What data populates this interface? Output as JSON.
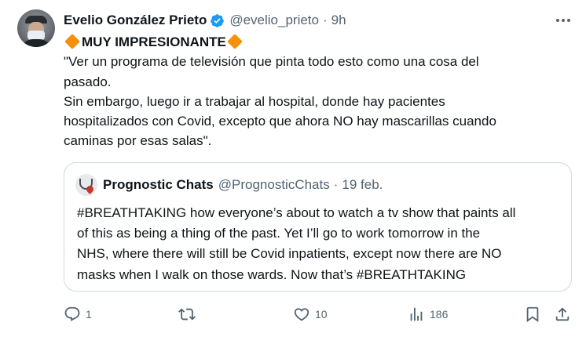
{
  "tweet": {
    "author": {
      "display_name": "Evelio González Prieto",
      "handle": "@evelio_prieto",
      "time": "9h",
      "separator": "·",
      "verified_icon": "verified-badge-icon",
      "avatar": "avatar"
    },
    "headline": "MUY IMPRESIONANTE",
    "headline_emoji": "orange-diamond",
    "body_lines": [
      "\"Ver un programa de televisión que pinta todo esto como una cosa del",
      "pasado.",
      "Sin embargo, luego ir a trabajar al hospital, donde hay pacientes",
      "hospitalizados con Covid, excepto que ahora NO hay mascarillas cuando",
      "caminas por esas salas\"."
    ],
    "more_icon": "more-options-icon",
    "quote": {
      "display_name": "Prognostic Chats",
      "handle": "@PrognosticChats",
      "separator": "·",
      "date": "19 feb.",
      "body_lines": [
        "#BREATHTAKING how everyone’s about to watch a tv show that paints all",
        "of this as being a thing of the past. Yet I’ll go to work tomorrow in the",
        "NHS, where there will still be Covid inpatients, except now there are NO",
        "masks when I walk on those wards. Now that’s #BREATHTAKING"
      ]
    },
    "actions": {
      "reply": {
        "icon": "reply-icon",
        "count": "1"
      },
      "retweet": {
        "icon": "retweet-icon",
        "count": ""
      },
      "like": {
        "icon": "heart-icon",
        "count": "10"
      },
      "views": {
        "icon": "views-chart-icon",
        "count": "186"
      },
      "bookmark": {
        "icon": "bookmark-icon"
      },
      "share": {
        "icon": "share-icon"
      }
    },
    "colors": {
      "text": "#0f1419",
      "secondary": "#536471",
      "verified": "#1d9bf0",
      "diamond": "#f4900c",
      "border": "#cfd9de"
    }
  }
}
